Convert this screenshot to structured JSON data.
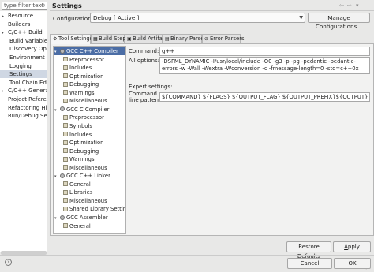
{
  "filter": {
    "placeholder": "type filter text",
    "clear_icon": "clear-icon"
  },
  "nav": {
    "items": [
      {
        "label": "Resource",
        "expander": "▸",
        "indent": 0
      },
      {
        "label": "Builders",
        "expander": "",
        "indent": 0
      },
      {
        "label": "C/C++ Build",
        "expander": "▾",
        "indent": 0
      },
      {
        "label": "Build Variables",
        "expander": "",
        "indent": 1
      },
      {
        "label": "Discovery Options",
        "expander": "",
        "indent": 1
      },
      {
        "label": "Environment",
        "expander": "",
        "indent": 1
      },
      {
        "label": "Logging",
        "expander": "",
        "indent": 1
      },
      {
        "label": "Settings",
        "expander": "",
        "indent": 1,
        "selected": true
      },
      {
        "label": "Tool Chain Editor",
        "expander": "",
        "indent": 1
      },
      {
        "label": "C/C++ General",
        "expander": "▸",
        "indent": 0
      },
      {
        "label": "Project References",
        "expander": "",
        "indent": 0
      },
      {
        "label": "Refactoring History",
        "expander": "",
        "indent": 0
      },
      {
        "label": "Run/Debug Settings",
        "expander": "",
        "indent": 0
      }
    ]
  },
  "header": {
    "title": "Settings"
  },
  "configuration": {
    "label": "Configuration:",
    "value": "Debug  [ Active ]",
    "manage_label": "Manage Configurations..."
  },
  "tabs": [
    {
      "label": "Tool Settings",
      "icon": "tool-settings-icon",
      "glyph": "⚙",
      "active": true
    },
    {
      "label": "Build Steps",
      "icon": "build-steps-icon",
      "glyph": "▦"
    },
    {
      "label": "Build Artifact",
      "icon": "build-artifact-icon",
      "glyph": "▣"
    },
    {
      "label": "Binary Parsers",
      "icon": "binary-parsers-icon",
      "glyph": "▤"
    },
    {
      "label": "Error Parsers",
      "icon": "error-parsers-icon",
      "glyph": "⊘"
    }
  ],
  "tool_tree": [
    {
      "label": "GCC C++ Compiler",
      "level": 0,
      "expander": "▾",
      "icon": "gear",
      "selected": true
    },
    {
      "label": "Preprocessor",
      "level": 1
    },
    {
      "label": "Includes",
      "level": 1
    },
    {
      "label": "Optimization",
      "level": 1
    },
    {
      "label": "Debugging",
      "level": 1
    },
    {
      "label": "Warnings",
      "level": 1
    },
    {
      "label": "Miscellaneous",
      "level": 1
    },
    {
      "label": "GCC C Compiler",
      "level": 0,
      "expander": "▾",
      "icon": "gear"
    },
    {
      "label": "Preprocessor",
      "level": 1
    },
    {
      "label": "Symbols",
      "level": 1
    },
    {
      "label": "Includes",
      "level": 1
    },
    {
      "label": "Optimization",
      "level": 1
    },
    {
      "label": "Debugging",
      "level": 1
    },
    {
      "label": "Warnings",
      "level": 1
    },
    {
      "label": "Miscellaneous",
      "level": 1
    },
    {
      "label": "GCC C++ Linker",
      "level": 0,
      "expander": "▾",
      "icon": "gear"
    },
    {
      "label": "General",
      "level": 1
    },
    {
      "label": "Libraries",
      "level": 1
    },
    {
      "label": "Miscellaneous",
      "level": 1
    },
    {
      "label": "Shared Library Settings",
      "level": 1
    },
    {
      "label": "GCC Assembler",
      "level": 0,
      "expander": "▾",
      "icon": "gear"
    },
    {
      "label": "General",
      "level": 1
    }
  ],
  "form": {
    "command_label": "Command:",
    "command_value": "g++",
    "all_options_label": "All options:",
    "all_options_value": "-DSFML_DYNAMIC -I/usr/local/include -O0 -g3 -p -pg -pedantic -pedantic-errors -w -Wall -Wextra -Wconversion -c -fmessage-length=0 -std=c++0x",
    "expert_label": "Expert settings:",
    "cmdline_label_1": "Command",
    "cmdline_label_2": "line pattern:",
    "cmdline_value": "${COMMAND} ${FLAGS} ${OUTPUT_FLAG} ${OUTPUT_PREFIX}${OUTPUT} ${INPUTS}"
  },
  "buttons": {
    "restore_prefix": "Restore ",
    "restore_underlined": "D",
    "restore_suffix": "efaults",
    "apply_prefix": "",
    "apply_underlined": "A",
    "apply_suffix": "pply",
    "cancel": "Cancel",
    "ok": "OK"
  },
  "nav_arrows": {
    "back": "⇦",
    "forward": "⇨",
    "menu": "▾"
  },
  "help_glyph": "?"
}
